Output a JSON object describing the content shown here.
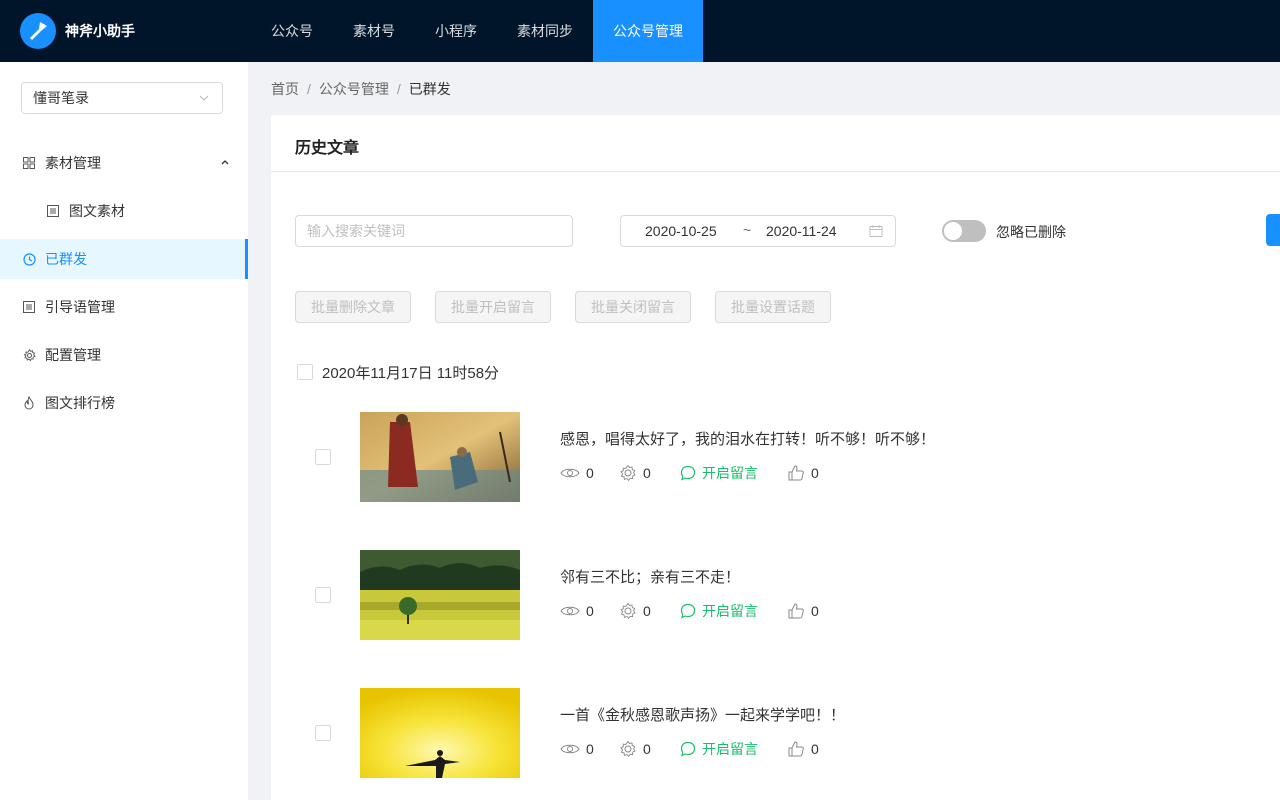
{
  "app": {
    "title": "神斧小助手"
  },
  "topnav": [
    {
      "label": "公众号",
      "active": false
    },
    {
      "label": "素材号",
      "active": false
    },
    {
      "label": "小程序",
      "active": false
    },
    {
      "label": "素材同步",
      "active": false
    },
    {
      "label": "公众号管理",
      "active": true
    }
  ],
  "sidebar": {
    "account": "懂哥笔录",
    "items": [
      {
        "label": "素材管理",
        "icon": "grid-icon",
        "expanded": true
      },
      {
        "label": "图文素材",
        "icon": "document-icon",
        "sub": true
      },
      {
        "label": "已群发",
        "icon": "clock-icon",
        "active": true
      },
      {
        "label": "引导语管理",
        "icon": "document-icon"
      },
      {
        "label": "配置管理",
        "icon": "gear-icon"
      },
      {
        "label": "图文排行榜",
        "icon": "flame-icon"
      }
    ]
  },
  "breadcrumb": [
    "首页",
    "公众号管理",
    "已群发"
  ],
  "card": {
    "title": "历史文章",
    "search_placeholder": "输入搜索关键词",
    "date_start": "2020-10-25",
    "date_sep": "~",
    "date_end": "2020-11-24",
    "ignore_deleted_label": "忽略已删除",
    "ignore_deleted_on": false
  },
  "batch_buttons": [
    "批量删除文章",
    "批量开启留言",
    "批量关闭留言",
    "批量设置话题"
  ],
  "group": {
    "date": "2020年11月17日 11时58分",
    "articles": [
      {
        "title": "感恩，唱得太好了，我的泪水在打转！听不够！听不够！",
        "views": "0",
        "shares": "0",
        "comment_label": "开启留言",
        "likes": "0"
      },
      {
        "title": "邻有三不比；亲有三不走！",
        "views": "0",
        "shares": "0",
        "comment_label": "开启留言",
        "likes": "0"
      },
      {
        "title": "一首《金秋感恩歌声扬》一起来学学吧！！",
        "views": "0",
        "shares": "0",
        "comment_label": "开启留言",
        "likes": "0"
      }
    ]
  },
  "colors": {
    "primary": "#1890ff",
    "header_bg": "#001529",
    "comment_green": "#19be6b"
  }
}
